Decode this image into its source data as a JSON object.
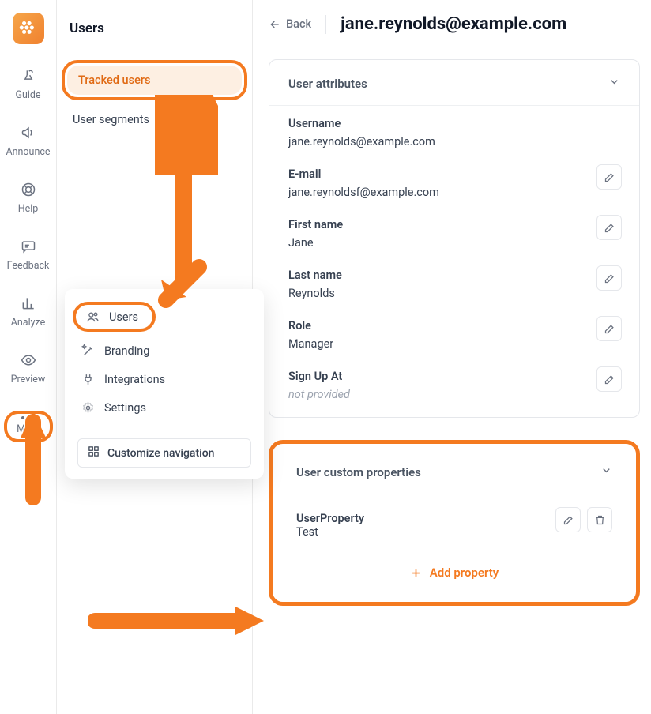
{
  "rail": {
    "guide": "Guide",
    "announce": "Announce",
    "help": "Help",
    "feedback": "Feedback",
    "analyze": "Analyze",
    "preview": "Preview",
    "more": "More"
  },
  "sidebar": {
    "title": "Users",
    "tracked": "Tracked users",
    "segments": "User segments"
  },
  "popover": {
    "users": "Users",
    "branding": "Branding",
    "integrations": "Integrations",
    "settings": "Settings",
    "customize": "Customize navigation"
  },
  "header": {
    "back": "Back",
    "title": "jane.reynolds@example.com"
  },
  "attributes": {
    "section_title": "User attributes",
    "username": {
      "label": "Username",
      "value": "jane.reynolds@example.com",
      "editable": false
    },
    "email": {
      "label": "E-mail",
      "value": "jane.reynoldsf@example.com",
      "editable": true
    },
    "first": {
      "label": "First name",
      "value": "Jane",
      "editable": true
    },
    "last": {
      "label": "Last name",
      "value": "Reynolds",
      "editable": true
    },
    "role": {
      "label": "Role",
      "value": "Manager",
      "editable": true
    },
    "signup": {
      "label": "Sign Up At",
      "value": "not provided",
      "editable": true,
      "not_provided": true
    }
  },
  "custom": {
    "section_title": "User custom properties",
    "prop": {
      "label": "UserProperty",
      "value": "Test"
    },
    "add": "Add property"
  }
}
